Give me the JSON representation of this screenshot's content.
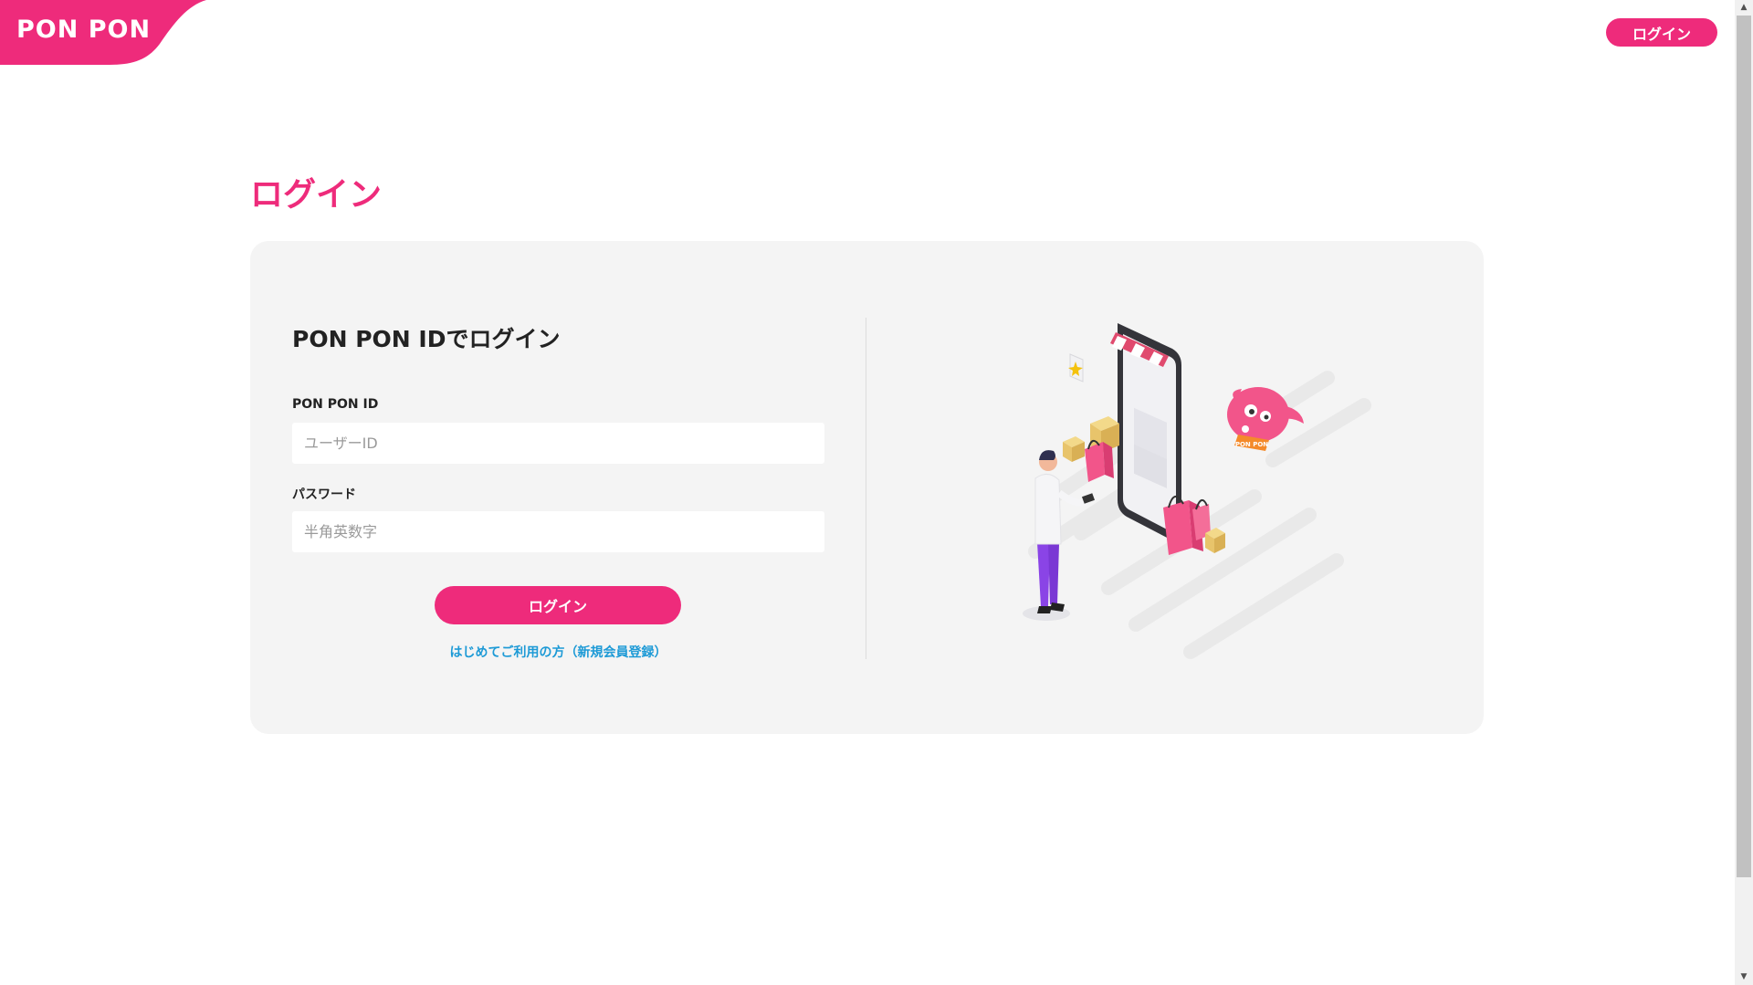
{
  "brand": {
    "logo_text": "PON PON",
    "accent_color": "#ee2b7b",
    "link_color": "#1d9ad6"
  },
  "header": {
    "login_label": "ログイン"
  },
  "page": {
    "title": "ログイン"
  },
  "form": {
    "heading": "PON PON IDでログイン",
    "id_label": "PON PON ID",
    "id_placeholder": "ユーザーID",
    "id_value": "",
    "password_label": "パスワード",
    "password_placeholder": "半角英数字",
    "password_value": "",
    "submit_label": "ログイン",
    "register_link": "はじめてご利用の方（新規会員登録）"
  },
  "illustration": {
    "description_icon": "shopping-illustration",
    "mascot_badge": "PON PON"
  }
}
